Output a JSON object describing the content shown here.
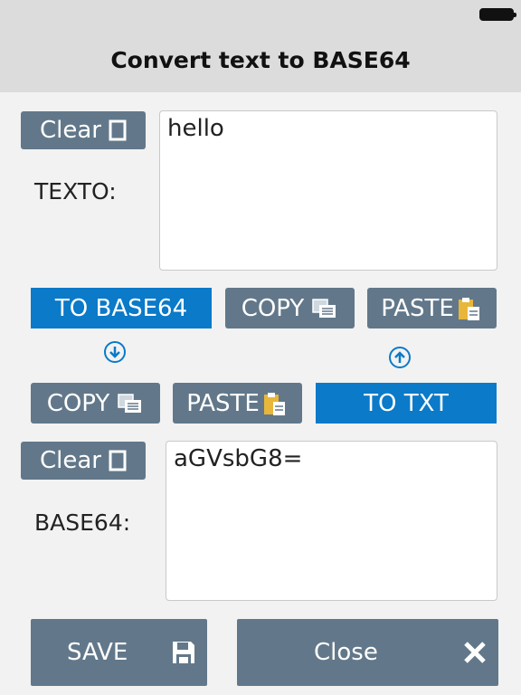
{
  "header": {
    "title": "Convert text to BASE64"
  },
  "text_section": {
    "clear_label": "Clear",
    "field_label": "TEXTO:",
    "value": "hello"
  },
  "row1": {
    "to_base64_label": "TO BASE64",
    "copy_label": "COPY",
    "paste_label": "PASTE"
  },
  "row2": {
    "copy_label": "COPY",
    "paste_label": "PASTE",
    "to_txt_label": "TO TXT"
  },
  "base64_section": {
    "clear_label": "Clear",
    "field_label": "BASE64:",
    "value": "aGVsbG8="
  },
  "footer": {
    "save_label": "SAVE",
    "close_label": "Close"
  },
  "colors": {
    "button_gray": "#62788a",
    "button_blue": "#0a7ac9",
    "header_bg": "#dcdcdc"
  }
}
